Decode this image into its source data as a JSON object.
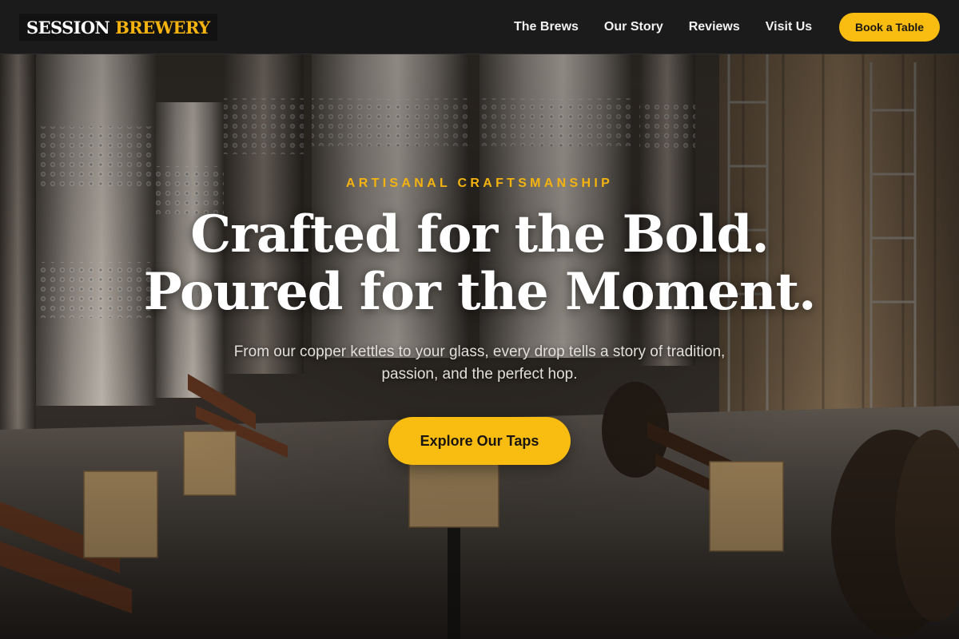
{
  "brand": {
    "word1": "SESSION",
    "word2": "BREWERY"
  },
  "nav": {
    "items": [
      {
        "label": "The Brews"
      },
      {
        "label": "Our Story"
      },
      {
        "label": "Reviews"
      },
      {
        "label": "Visit Us"
      }
    ],
    "book_label": "Book a Table"
  },
  "hero": {
    "eyebrow": "ARTISANAL CRAFTSMANSHIP",
    "headline_line1": "Crafted for the Bold.",
    "headline_line2": "Poured for the Moment.",
    "subcopy": "From our copper kettles to your glass, every drop tells a story of tradition, passion, and the perfect hop.",
    "cta_label": "Explore Our Taps"
  },
  "colors": {
    "accent": "#f8bd10",
    "header_bg": "#1b1b1b",
    "headline": "#ffffff"
  }
}
